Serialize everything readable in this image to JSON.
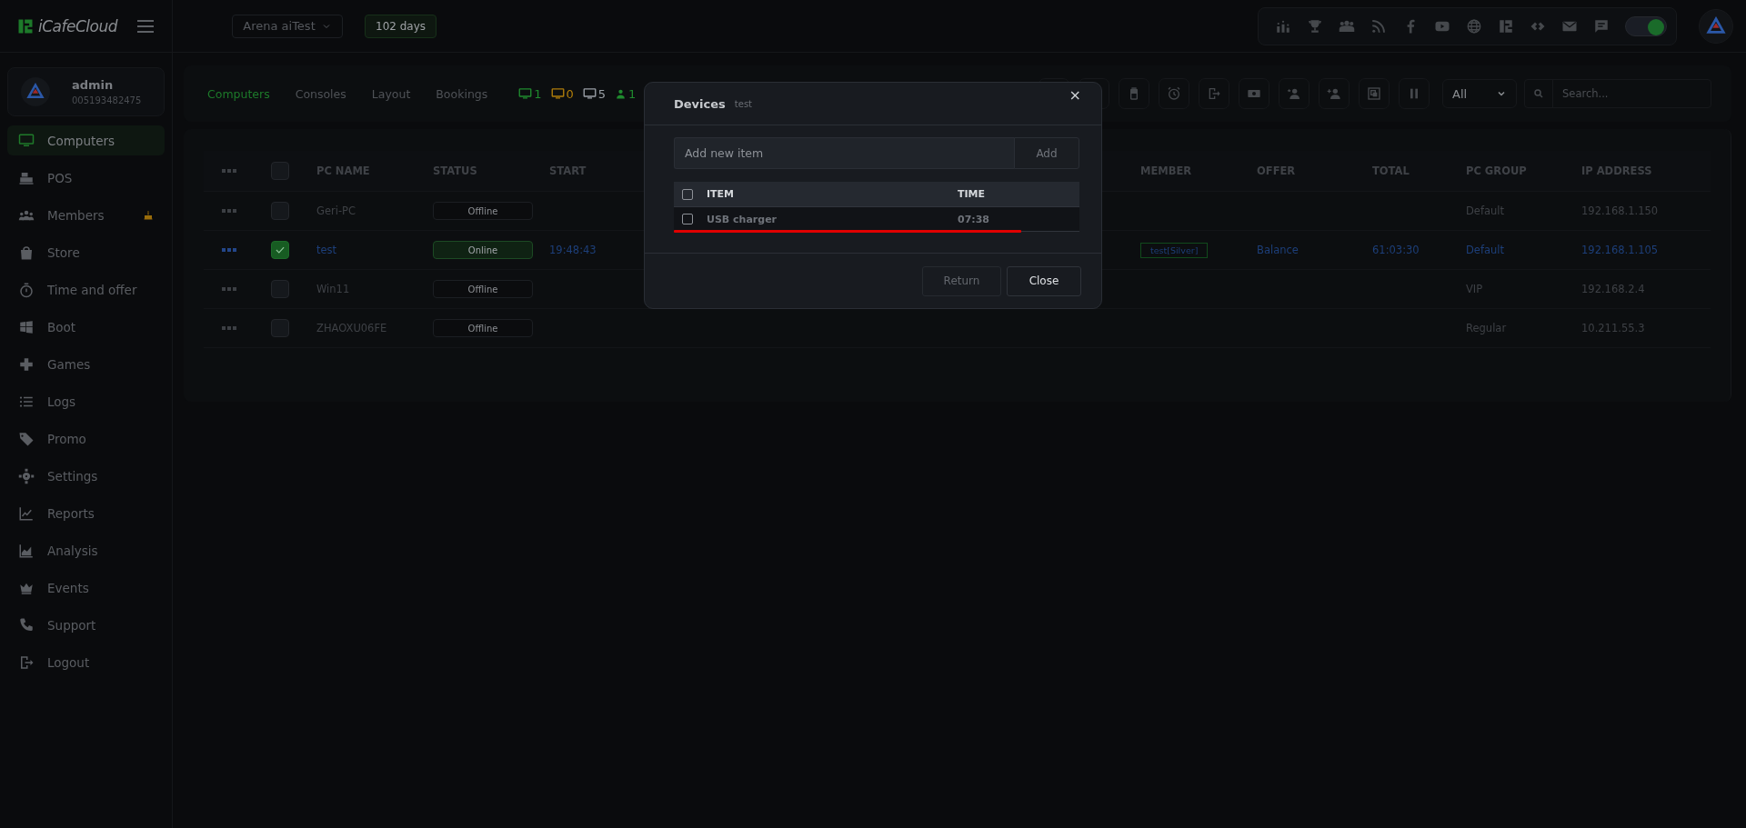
{
  "brand": {
    "name": "iCafeCloud"
  },
  "topbar": {
    "cafe_select": "Arena aiTest",
    "license_badge": "102 days",
    "theme_toggle": {
      "on": true
    }
  },
  "user": {
    "name": "admin",
    "id": "005193482475"
  },
  "sidebar": {
    "items": [
      {
        "label": "Computers",
        "selected": true
      },
      {
        "label": "POS",
        "selected": false
      },
      {
        "label": "Members",
        "selected": false,
        "badge_icon": true
      },
      {
        "label": "Store",
        "selected": false
      },
      {
        "label": "Time and offer",
        "selected": false
      },
      {
        "label": "Boot",
        "selected": false
      },
      {
        "label": "Games",
        "selected": false
      },
      {
        "label": "Logs",
        "selected": false
      },
      {
        "label": "Promo",
        "selected": false
      },
      {
        "label": "Settings",
        "selected": false
      },
      {
        "label": "Reports",
        "selected": false
      },
      {
        "label": "Analysis",
        "selected": false
      },
      {
        "label": "Events",
        "selected": false
      },
      {
        "label": "Support",
        "selected": false
      },
      {
        "label": "Logout",
        "selected": false
      }
    ]
  },
  "tabs": [
    {
      "label": "Computers",
      "selected": true
    },
    {
      "label": "Consoles",
      "selected": false
    },
    {
      "label": "Layout",
      "selected": false
    },
    {
      "label": "Bookings",
      "selected": false
    }
  ],
  "counters": [
    {
      "kind": "monitor",
      "value": "1",
      "color": "#1f8a2e"
    },
    {
      "kind": "monitor",
      "value": "0",
      "color": "#b07d0a"
    },
    {
      "kind": "monitor",
      "value": "5",
      "color": "#9aa0a6"
    },
    {
      "kind": "person",
      "value": "1",
      "color": "#1f8a2e"
    }
  ],
  "filter": {
    "value": "All"
  },
  "search": {
    "placeholder": "Search..."
  },
  "table": {
    "select_all_checked": false,
    "columns": [
      "PC NAME",
      "STATUS",
      "START",
      "MEMBER",
      "OFFER",
      "TOTAL",
      "PC GROUP",
      "IP ADDRESS"
    ],
    "rows": [
      {
        "selected": false,
        "pc_name": "Geri-PC",
        "status": "Offline",
        "online": false,
        "pc_group": "Default",
        "ip_address": "192.168.1.150"
      },
      {
        "selected": true,
        "pc_name": "test",
        "status": "Online",
        "online": true,
        "start": "19:48:43",
        "member": "test[Silver]",
        "offer": "Balance",
        "total": "61:03:30",
        "pc_group": "Default",
        "ip_address": "192.168.1.105"
      },
      {
        "selected": false,
        "pc_name": "Win11",
        "status": "Offline",
        "online": false,
        "pc_group": "VIP",
        "ip_address": "192.168.2.4"
      },
      {
        "selected": false,
        "pc_name": "ZHAOXU06FE",
        "status": "Offline",
        "online": false,
        "pc_group": "Regular",
        "ip_address": "10.211.55.3"
      }
    ]
  },
  "dialog": {
    "title": "Devices",
    "subtitle": "test",
    "close": "×",
    "input": {
      "placeholder": "Add new item"
    },
    "add_button": "Add",
    "columns": [
      "ITEM",
      "TIME"
    ],
    "items": [
      {
        "item": "USB charger",
        "time": "07:38",
        "checked": false
      }
    ],
    "header_checked": false,
    "buttons": [
      {
        "label": "Return",
        "disabled": true
      },
      {
        "label": "Close",
        "disabled": false
      }
    ]
  }
}
